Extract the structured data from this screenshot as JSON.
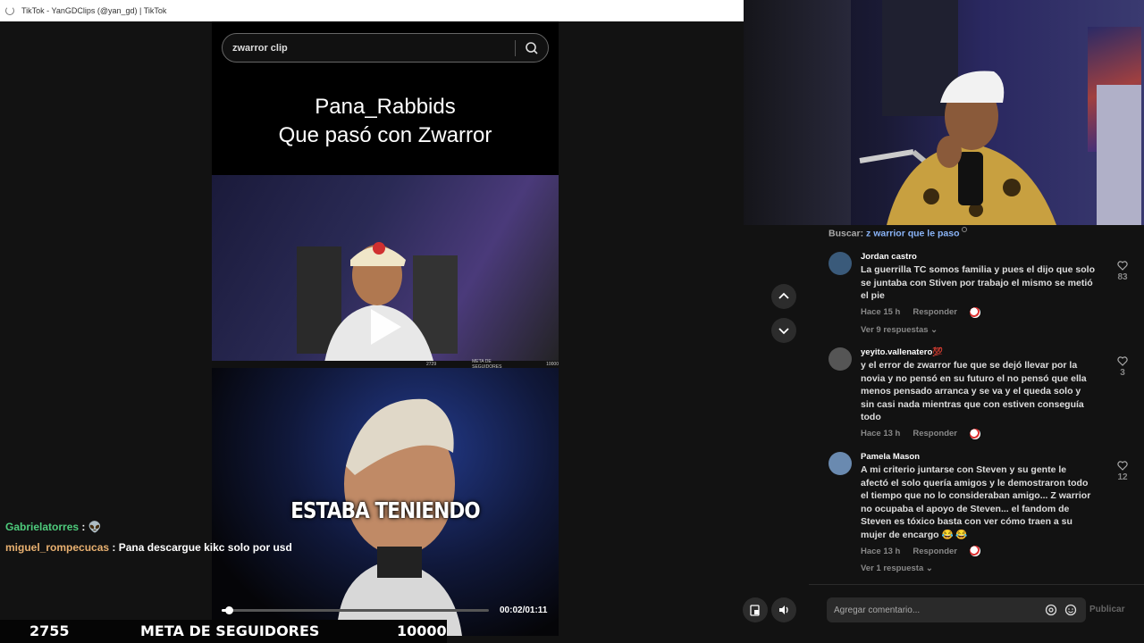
{
  "window": {
    "title": "TikTok - YanGDClips (@yan_gd) | TikTok"
  },
  "player": {
    "search_value": "zwarror clip",
    "title_line1": "Pana_Rabbids",
    "title_line2": "Que pasó con Zwarror",
    "caption": "ESTABA TENIENDO",
    "time": "00:02/01:11",
    "progress": 0.03,
    "embedded_strip": {
      "count": "2729",
      "label": "META DE SEGUIDORES",
      "goal": "10000"
    }
  },
  "comments": {
    "buscar_label": "Buscar:",
    "buscar_term": "z warrior que le paso",
    "items": [
      {
        "user": "Jordan castro",
        "text": "La guerrilla TC somos familia y pues el dijo que solo se juntaba con Stiven por trabajo el mismo se metió el pie",
        "time": "Hace 15 h",
        "reply": "Responder",
        "likes": "83",
        "replies": "Ver 9 respuestas",
        "avatar_color": "#3a5a7a"
      },
      {
        "user": "yeyito.vallenatero",
        "user_emoji": "💯",
        "text": "y el error de zwarror fue que se dejó llevar por la novia y no pensó en su futuro el no pensó que ella menos pensado arranca y se va y el queda solo y sin casi nada mientras que con estiven conseguía todo",
        "time": "Hace 13 h",
        "reply": "Responder",
        "likes": "3",
        "replies": "",
        "avatar_color": "#555"
      },
      {
        "user": "Pamela Mason",
        "text": "A mi criterio juntarse con Steven y su gente le afectó el solo quería amigos y le demostraron todo el tiempo que no lo consideraban amigo... Z warrior no ocupaba el apoyo de Steven... el fandom de Steven es tóxico basta con ver cómo traen a su mujer de encargo 😂 😂",
        "time": "Hace 13 h",
        "reply": "Responder",
        "likes": "12",
        "replies": "Ver 1 respuesta",
        "avatar_color": "#6a8ab0"
      }
    ],
    "input_placeholder": "Agregar comentario...",
    "publish_label": "Publicar"
  },
  "chat": [
    {
      "user": "Gabrielatorres",
      "sep": " :",
      "msg": "👽"
    },
    {
      "user": "miguel_rompecucas",
      "sep": " :",
      "msg": " Pana descargue kikc solo por usd"
    }
  ],
  "overlay": {
    "count": "2755",
    "label": "META DE SEGUIDORES",
    "goal": "10000"
  },
  "icons": [
    "refresh-icon",
    "search-icon",
    "chevron-up-icon",
    "chevron-down-icon",
    "heart-icon",
    "at-icon",
    "emoji-icon",
    "pip-icon",
    "volume-icon"
  ]
}
